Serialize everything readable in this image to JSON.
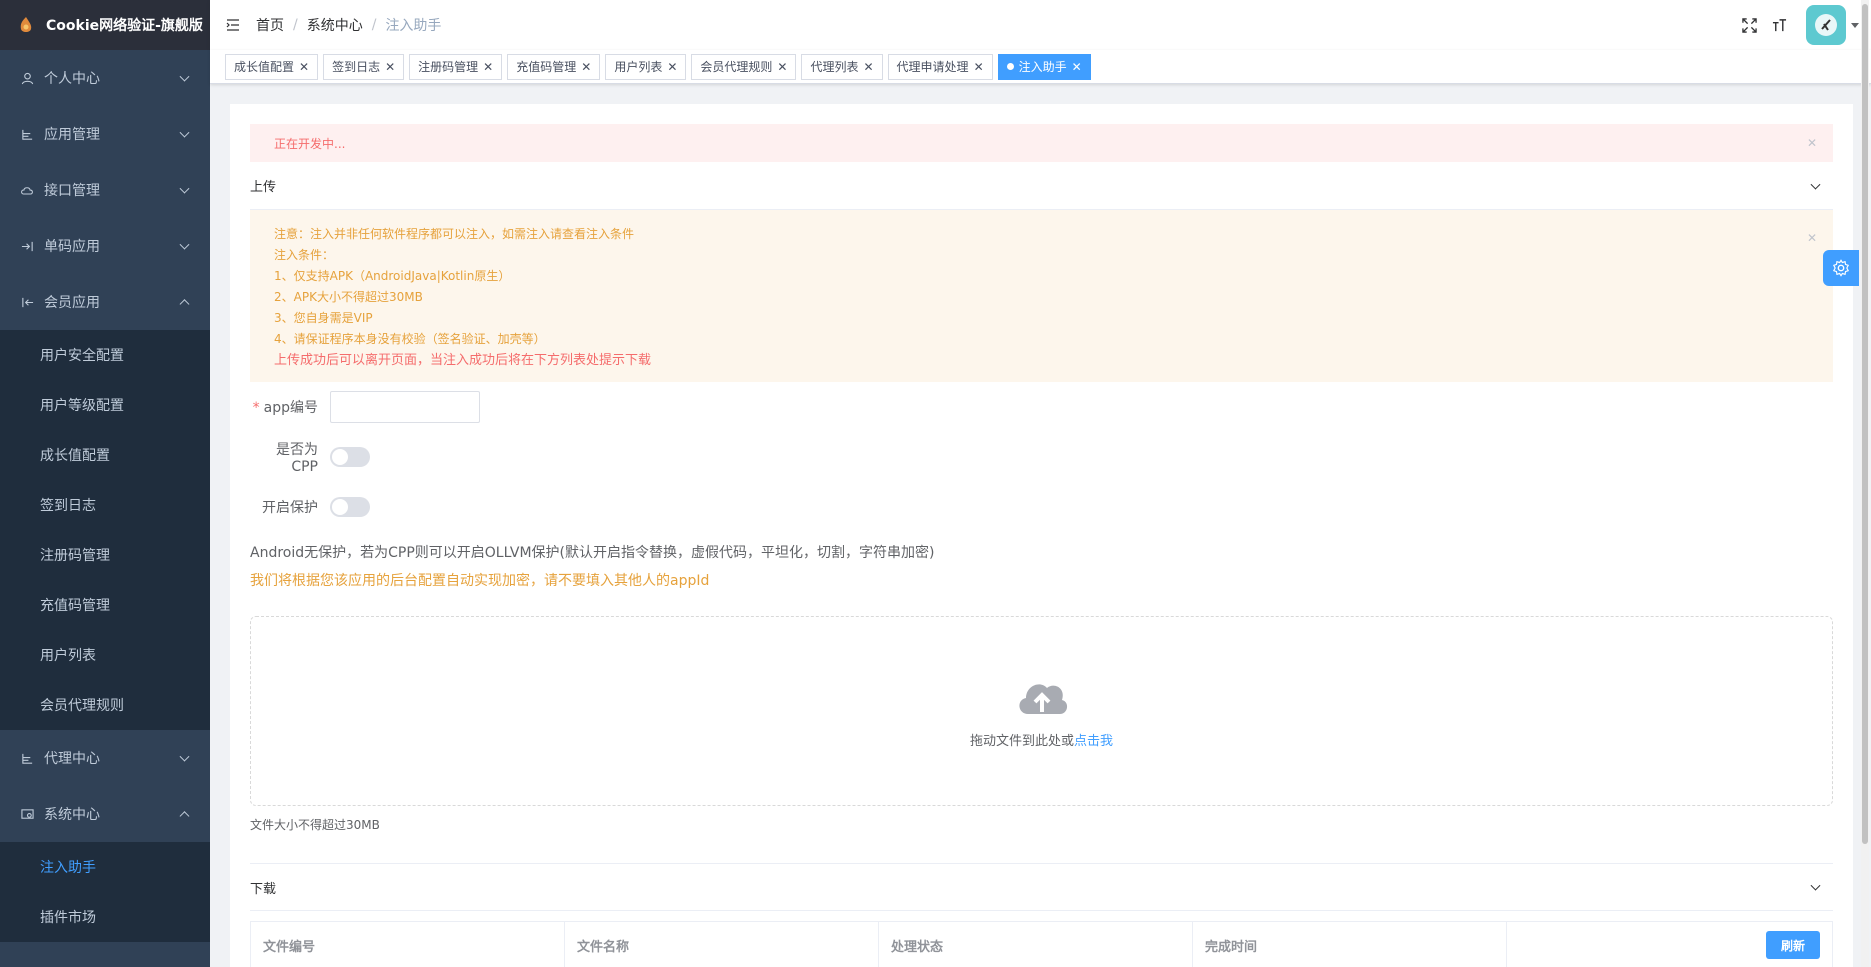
{
  "app": {
    "title": "Cookie网络验证-旗舰版"
  },
  "sidebar": {
    "top_items": [
      {
        "label": "个人中心",
        "icon": "user-icon"
      },
      {
        "label": "应用管理",
        "icon": "tree-icon"
      },
      {
        "label": "接口管理",
        "icon": "cloud-icon"
      },
      {
        "label": "单码应用",
        "icon": "login-icon"
      },
      {
        "label": "会员应用",
        "icon": "logout-icon"
      }
    ],
    "member_sub": [
      "用户安全配置",
      "用户等级配置",
      "成长值配置",
      "签到日志",
      "注册码管理",
      "充值码管理",
      "用户列表",
      "会员代理规则"
    ],
    "agent": {
      "label": "代理中心"
    },
    "system": {
      "label": "系统中心"
    },
    "system_sub": [
      "注入助手",
      "插件市场"
    ]
  },
  "breadcrumb": {
    "home": "首页",
    "level1": "系统中心",
    "current": "注入助手"
  },
  "tags": [
    "成长值配置",
    "签到日志",
    "注册码管理",
    "充值码管理",
    "用户列表",
    "会员代理规则",
    "代理列表",
    "代理申请处理"
  ],
  "active_tag": "注入助手",
  "page": {
    "dev_alert": "正在开发中...",
    "upload_section": "上传",
    "warn_lines": [
      "注意：注入并非任何软件程序都可以注入，如需注入请查看注入条件",
      "注入条件：",
      "1、仅支持APK（AndroidJava|Kotlin原生）",
      "2、APK大小不得超过30MB",
      "3、您自身需是VIP",
      "4、请保证程序本身没有校验（签名验证、加壳等）"
    ],
    "warn_big": "上传成功后可以离开页面，当注入成功后将在下方列表处提示下载",
    "form": {
      "app_label": "app编号",
      "cpp_label": "是否为CPP",
      "protect_label": "开启保护"
    },
    "info1": "Android无保护，若为CPP则可以开启OLLVM保护(默认开启指令替换，虚假代码，平坦化，切割，字符串加密)",
    "info2": "我们将根据您该应用的后台配置自动实现加密，请不要填入其他人的appId",
    "upload_text": "拖动文件到此处或",
    "upload_link": "点击我",
    "upload_tip": "文件大小不得超过30MB",
    "download_section": "下载",
    "table_headers": [
      "文件编号",
      "文件名称",
      "处理状态",
      "完成时间"
    ],
    "refresh": "刷新"
  },
  "colors": {
    "sidebar_bg": "#304156",
    "primary": "#409eff",
    "danger": "#f56c6c",
    "warning": "#e6a23c"
  }
}
